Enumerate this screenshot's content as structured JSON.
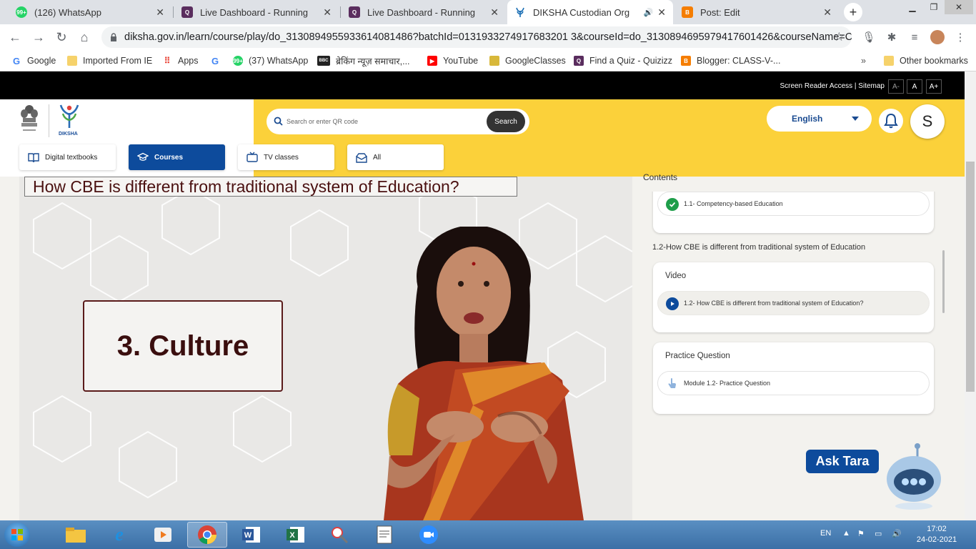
{
  "browser": {
    "tabs": [
      {
        "title": "(126) WhatsApp",
        "badge": "99+"
      },
      {
        "title": "Live Dashboard - Running"
      },
      {
        "title": "Live Dashboard - Running"
      },
      {
        "title": "DIKSHA Custodian Org"
      },
      {
        "title": "Post: Edit"
      }
    ],
    "url": "diksha.gov.in/learn/course/play/do_3130894955933614081486?batchId=0131933274917683201 3&courseId=do_3130894695979417601426&courseName=C...",
    "bookmarks": [
      "Google",
      "Imported From IE",
      "Apps",
      "(37) WhatsApp",
      "ब्रेकिंग न्यूज़ समाचार,...",
      "YouTube",
      "GoogleClasses",
      "Find a Quiz - Quizizz",
      "Blogger: CLASS-V-...",
      "Other bookmarks"
    ],
    "bookmark_badges": {
      "whatsapp": "99+",
      "bbc": "BBC"
    }
  },
  "site": {
    "top_links": "Screen Reader Access | Sitemap",
    "font_buttons": [
      "A-",
      "A",
      "A+"
    ],
    "logo_text": "DIKSHA",
    "search_placeholder": "Search or enter QR code",
    "search_button": "Search",
    "language": "English",
    "avatar_initial": "S",
    "nav": [
      {
        "label": "Digital textbooks",
        "active": false
      },
      {
        "label": "Courses",
        "active": true
      },
      {
        "label": "TV classes",
        "active": false
      },
      {
        "label": "All",
        "active": false
      }
    ]
  },
  "video": {
    "slide_title": "How CBE is different from traditional system of Education?",
    "slide_point": "3. Culture"
  },
  "contents": {
    "label": "Contents",
    "completed_item": "1.1- Competency-based Education",
    "section_heading": "1.2-How CBE is different from traditional system of Education",
    "video_card_title": "Video",
    "video_item": "1.2- How CBE is different from traditional system of Education?",
    "practice_card_title": "Practice Question",
    "practice_item": "Module 1.2- Practice Question"
  },
  "assistant": {
    "label": "Ask Tara"
  },
  "taskbar": {
    "language": "EN",
    "time": "17:02",
    "date": "24-02-2021"
  },
  "colors": {
    "diksha_yellow": "#fbd13a",
    "diksha_blue": "#0d4b9c",
    "check_green": "#1e9e4a"
  }
}
